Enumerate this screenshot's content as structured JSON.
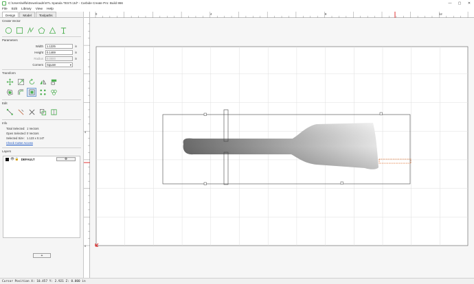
{
  "window": {
    "title": "C:\\Users\\wllfa\\Downloads\\STL Spatula TEST.c2d* - Carbide Create Pro: Build 866",
    "minimize": "—",
    "maximize": "▢",
    "close": "✕"
  },
  "menu": [
    "File",
    "Edit",
    "Library",
    "View",
    "Help"
  ],
  "tabs": [
    "Design",
    "Model",
    "Toolpaths"
  ],
  "sections": {
    "create_vector": "Create Vector",
    "parameters": "Parameters",
    "transform": "Transform",
    "edit": "Edit",
    "info": "Info",
    "layers": "Layers"
  },
  "parameters": {
    "width_label": "Width",
    "width_value": "1.1225",
    "width_unit": "in",
    "height_label": "Height",
    "height_value": "0.1469",
    "height_unit": "in",
    "radius_label": "Radius",
    "radius_value": "0.0000",
    "radius_unit": "in",
    "corners_label": "Corners",
    "corners_value": "Square"
  },
  "info": {
    "total_selected_label": "Total Selected:",
    "total_selected_value": "1 Vectors",
    "open_selected_label": "Open Selected:",
    "open_selected_value": "0 Vectors",
    "selected_size_label": "Selected Size:",
    "selected_size_value": "1.123 x 0.147",
    "check_link": "Check Cutter Access"
  },
  "layers": {
    "rows": [
      {
        "name": "DEFAULT",
        "gear": "⚙"
      }
    ],
    "add_button": "+"
  },
  "rulers": {
    "top_labels": [
      "0",
      "4",
      "8",
      "12"
    ],
    "left_labels": [
      "4",
      "0"
    ]
  },
  "status": {
    "text": "Cursor Position X: 10.457 Y: 2.921 Z: 0.000 in"
  },
  "colors": {
    "accent_green": "#4caf50",
    "selection_orange": "#e07030",
    "origin_red": "#e03030",
    "link_blue": "#1a55c5"
  },
  "icons": {
    "create": [
      "circle-icon",
      "rectangle-icon",
      "polyline-icon",
      "polygon-icon",
      "star-icon",
      "text-icon"
    ],
    "transform": [
      "move-icon",
      "scale-icon",
      "rotate-icon",
      "mirror-icon",
      "align-icon",
      "offset-icon",
      "fillet-icon",
      "select-all-icon",
      "array-icon",
      "group-icon"
    ],
    "edit": [
      "node-edit-icon",
      "trim-icon",
      "cut-icon",
      "boolean-icon",
      "join-icon"
    ]
  }
}
